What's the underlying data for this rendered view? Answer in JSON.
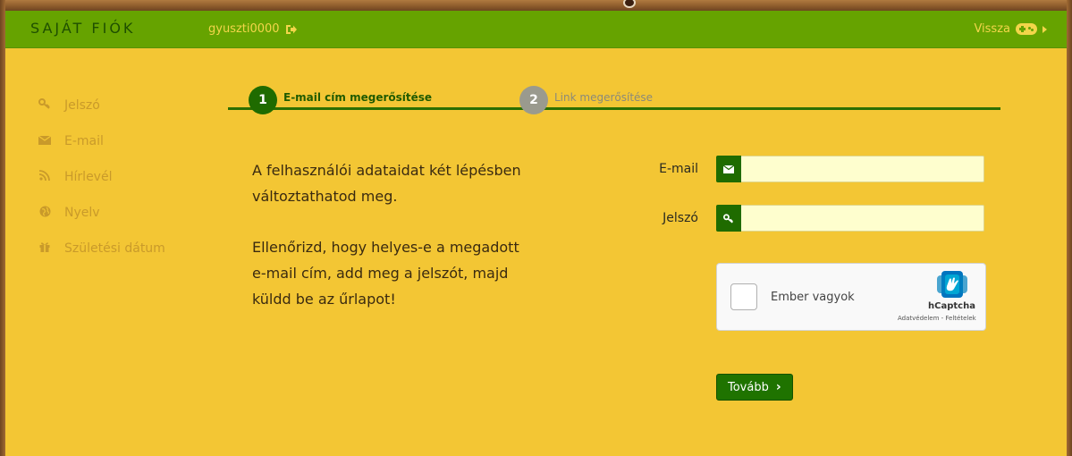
{
  "header": {
    "title": "SAJÁT FIÓK",
    "username": "gyuszti0000",
    "back_label": "Vissza"
  },
  "sidebar": {
    "items": [
      {
        "label": "Jelszó",
        "icon": "key-icon"
      },
      {
        "label": "E-mail",
        "icon": "envelope-icon"
      },
      {
        "label": "Hírlevél",
        "icon": "rss-icon"
      },
      {
        "label": "Nyelv",
        "icon": "globe-icon"
      },
      {
        "label": "Születési dátum",
        "icon": "gift-icon"
      }
    ]
  },
  "steps": [
    {
      "number": "1",
      "label": "E-mail cím megerősítése",
      "active": true
    },
    {
      "number": "2",
      "label": "Link megerősítése",
      "active": false
    }
  ],
  "intro": {
    "p1": "A felhasználói adataidat két lépésben változtathatod meg.",
    "p2": "Ellenőrizd, hogy helyes-e a megadott e-mail cím, add meg a jelszót, majd küldd be az űrlapot!"
  },
  "form": {
    "email_label": "E-mail",
    "email_value": "",
    "password_label": "Jelszó",
    "password_value": ""
  },
  "captcha": {
    "text": "Ember vagyok",
    "brand": "hCaptcha",
    "links": "Adatvédelem - Feltételek"
  },
  "submit_label": "Tovább",
  "colors": {
    "header_green": "#66a300",
    "panel_yellow": "#f3c634",
    "accent_green": "#1f6b00",
    "input_bg": "#fefece"
  }
}
